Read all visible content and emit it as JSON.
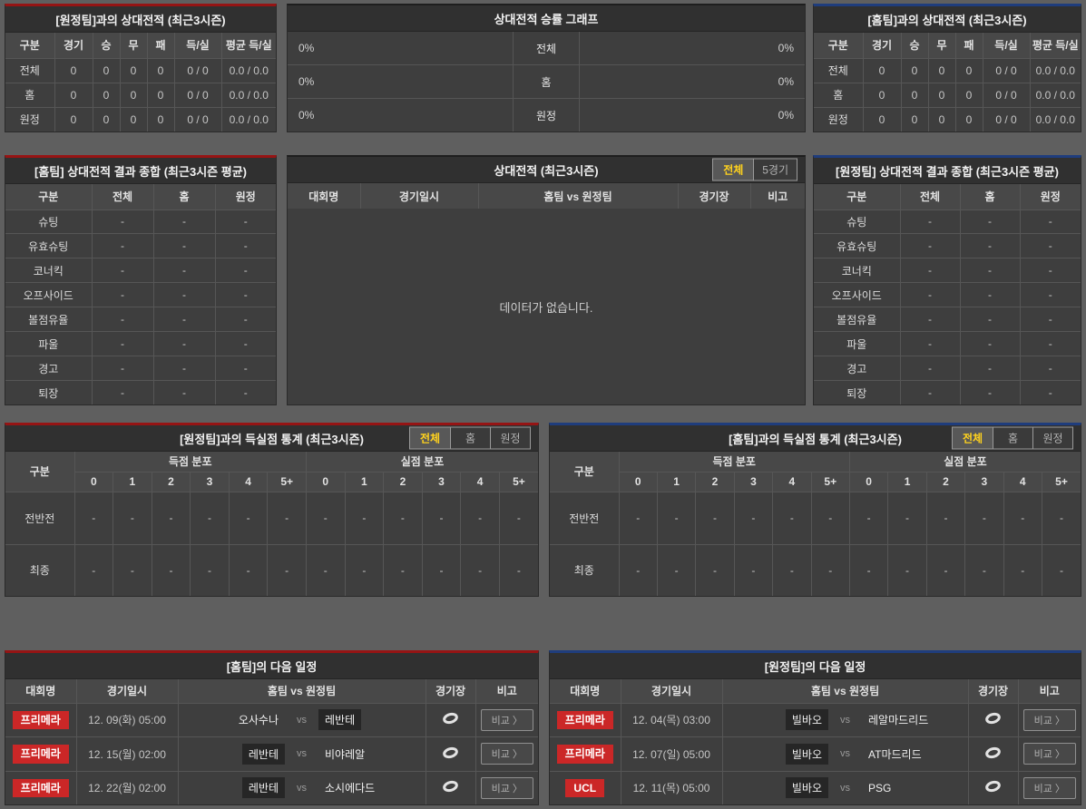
{
  "labels": {
    "vs": "vs",
    "compare": "비교 〉"
  },
  "colors": {
    "accent_red": "#961414",
    "accent_blue": "#1f3d7d",
    "badge_red": "#cb2727",
    "active_tab_text": "#ffd21e"
  },
  "top_away": {
    "title": "[원정팀]과의 상대전적 (최근3시즌)",
    "columns": [
      "구분",
      "경기",
      "승",
      "무",
      "패",
      "득/실",
      "평균 득/실"
    ],
    "rows": [
      {
        "label": "전체",
        "values": [
          "0",
          "0",
          "0",
          "0",
          "0 / 0",
          "0.0 / 0.0"
        ]
      },
      {
        "label": "홈",
        "values": [
          "0",
          "0",
          "0",
          "0",
          "0 / 0",
          "0.0 / 0.0"
        ]
      },
      {
        "label": "원정",
        "values": [
          "0",
          "0",
          "0",
          "0",
          "0 / 0",
          "0.0 / 0.0"
        ]
      }
    ]
  },
  "winrate": {
    "title": "상대전적 승률 그래프",
    "rows": [
      {
        "label": "전체",
        "left_pct": "0%",
        "right_pct": "0%",
        "left_value": 0,
        "right_value": 0
      },
      {
        "label": "홈",
        "left_pct": "0%",
        "right_pct": "0%",
        "left_value": 0,
        "right_value": 0
      },
      {
        "label": "원정",
        "left_pct": "0%",
        "right_pct": "0%",
        "left_value": 0,
        "right_value": 0
      }
    ]
  },
  "top_home": {
    "title": "[홈팀]과의 상대전적 (최근3시즌)",
    "columns": [
      "구분",
      "경기",
      "승",
      "무",
      "패",
      "득/실",
      "평균 득/실"
    ],
    "rows": [
      {
        "label": "전체",
        "values": [
          "0",
          "0",
          "0",
          "0",
          "0 / 0",
          "0.0 / 0.0"
        ]
      },
      {
        "label": "홈",
        "values": [
          "0",
          "0",
          "0",
          "0",
          "0 / 0",
          "0.0 / 0.0"
        ]
      },
      {
        "label": "원정",
        "values": [
          "0",
          "0",
          "0",
          "0",
          "0 / 0",
          "0.0 / 0.0"
        ]
      }
    ]
  },
  "home_summary": {
    "title": "[홈팀] 상대전적 결과 종합 (최근3시즌 평균)",
    "columns": [
      "구분",
      "전체",
      "홈",
      "원정"
    ],
    "rows": [
      {
        "label": "슈팅",
        "values": [
          "-",
          "-",
          "-"
        ]
      },
      {
        "label": "유효슈팅",
        "values": [
          "-",
          "-",
          "-"
        ]
      },
      {
        "label": "코너킥",
        "values": [
          "-",
          "-",
          "-"
        ]
      },
      {
        "label": "오프사이드",
        "values": [
          "-",
          "-",
          "-"
        ]
      },
      {
        "label": "볼점유율",
        "values": [
          "-",
          "-",
          "-"
        ]
      },
      {
        "label": "파울",
        "values": [
          "-",
          "-",
          "-"
        ]
      },
      {
        "label": "경고",
        "values": [
          "-",
          "-",
          "-"
        ]
      },
      {
        "label": "퇴장",
        "values": [
          "-",
          "-",
          "-"
        ]
      }
    ]
  },
  "h2h_list": {
    "title": "상대전적 (최근3시즌)",
    "tabs": [
      "전체",
      "5경기"
    ],
    "active_tab": "전체",
    "columns": [
      "대회명",
      "경기일시",
      "홈팀 vs 원정팀",
      "경기장",
      "비고"
    ],
    "empty": "데이터가 없습니다."
  },
  "away_summary": {
    "title": "[원정팀] 상대전적 결과 종합 (최근3시즌 평균)",
    "columns": [
      "구분",
      "전체",
      "홈",
      "원정"
    ],
    "rows": [
      {
        "label": "슈팅",
        "values": [
          "-",
          "-",
          "-"
        ]
      },
      {
        "label": "유효슈팅",
        "values": [
          "-",
          "-",
          "-"
        ]
      },
      {
        "label": "코너킥",
        "values": [
          "-",
          "-",
          "-"
        ]
      },
      {
        "label": "오프사이드",
        "values": [
          "-",
          "-",
          "-"
        ]
      },
      {
        "label": "볼점유율",
        "values": [
          "-",
          "-",
          "-"
        ]
      },
      {
        "label": "파울",
        "values": [
          "-",
          "-",
          "-"
        ]
      },
      {
        "label": "경고",
        "values": [
          "-",
          "-",
          "-"
        ]
      },
      {
        "label": "퇴장",
        "values": [
          "-",
          "-",
          "-"
        ]
      }
    ]
  },
  "away_goals": {
    "title": "[원정팀]과의 득실점 통계 (최근3시즌)",
    "tabs": [
      "전체",
      "홈",
      "원정"
    ],
    "active_tab": "전체",
    "col_label": "구분",
    "group_scored": "득점 분포",
    "group_conceded": "실점 분포",
    "bins": [
      "0",
      "1",
      "2",
      "3",
      "4",
      "5+"
    ],
    "rows": [
      {
        "label": "전반전",
        "values": [
          "-",
          "-",
          "-",
          "-",
          "-",
          "-",
          "-",
          "-",
          "-",
          "-",
          "-",
          "-"
        ]
      },
      {
        "label": "최종",
        "values": [
          "-",
          "-",
          "-",
          "-",
          "-",
          "-",
          "-",
          "-",
          "-",
          "-",
          "-",
          "-"
        ]
      }
    ]
  },
  "home_goals": {
    "title": "[홈팀]과의 득실점 통계 (최근3시즌)",
    "tabs": [
      "전체",
      "홈",
      "원정"
    ],
    "active_tab": "전체",
    "col_label": "구분",
    "group_scored": "득점 분포",
    "group_conceded": "실점 분포",
    "bins": [
      "0",
      "1",
      "2",
      "3",
      "4",
      "5+"
    ],
    "rows": [
      {
        "label": "전반전",
        "values": [
          "-",
          "-",
          "-",
          "-",
          "-",
          "-",
          "-",
          "-",
          "-",
          "-",
          "-",
          "-"
        ]
      },
      {
        "label": "최종",
        "values": [
          "-",
          "-",
          "-",
          "-",
          "-",
          "-",
          "-",
          "-",
          "-",
          "-",
          "-",
          "-"
        ]
      }
    ]
  },
  "home_schedule": {
    "title": "[홈팀]의 다음 일정",
    "columns": [
      "대회명",
      "경기일시",
      "홈팀 vs 원정팀",
      "경기장",
      "비고"
    ],
    "rows": [
      {
        "comp": "프리메라",
        "date": "12. 09(화) 05:00",
        "home": "오사수나",
        "away": "레반테",
        "home_hl": "0",
        "away_hl": "1"
      },
      {
        "comp": "프리메라",
        "date": "12. 15(월) 02:00",
        "home": "레반테",
        "away": "비야레알",
        "home_hl": "1",
        "away_hl": "0"
      },
      {
        "comp": "프리메라",
        "date": "12. 22(월) 02:00",
        "home": "레반테",
        "away": "소시에다드",
        "home_hl": "1",
        "away_hl": "0"
      }
    ]
  },
  "away_schedule": {
    "title": "[원정팀]의 다음 일정",
    "columns": [
      "대회명",
      "경기일시",
      "홈팀 vs 원정팀",
      "경기장",
      "비고"
    ],
    "rows": [
      {
        "comp": "프리메라",
        "date": "12. 04(목) 03:00",
        "home": "빌바오",
        "away": "레알마드리드",
        "home_hl": "1",
        "away_hl": "0"
      },
      {
        "comp": "프리메라",
        "date": "12. 07(일) 05:00",
        "home": "빌바오",
        "away": "AT마드리드",
        "home_hl": "1",
        "away_hl": "0"
      },
      {
        "comp": "UCL",
        "date": "12. 11(목) 05:00",
        "home": "빌바오",
        "away": "PSG",
        "home_hl": "1",
        "away_hl": "0"
      }
    ]
  }
}
